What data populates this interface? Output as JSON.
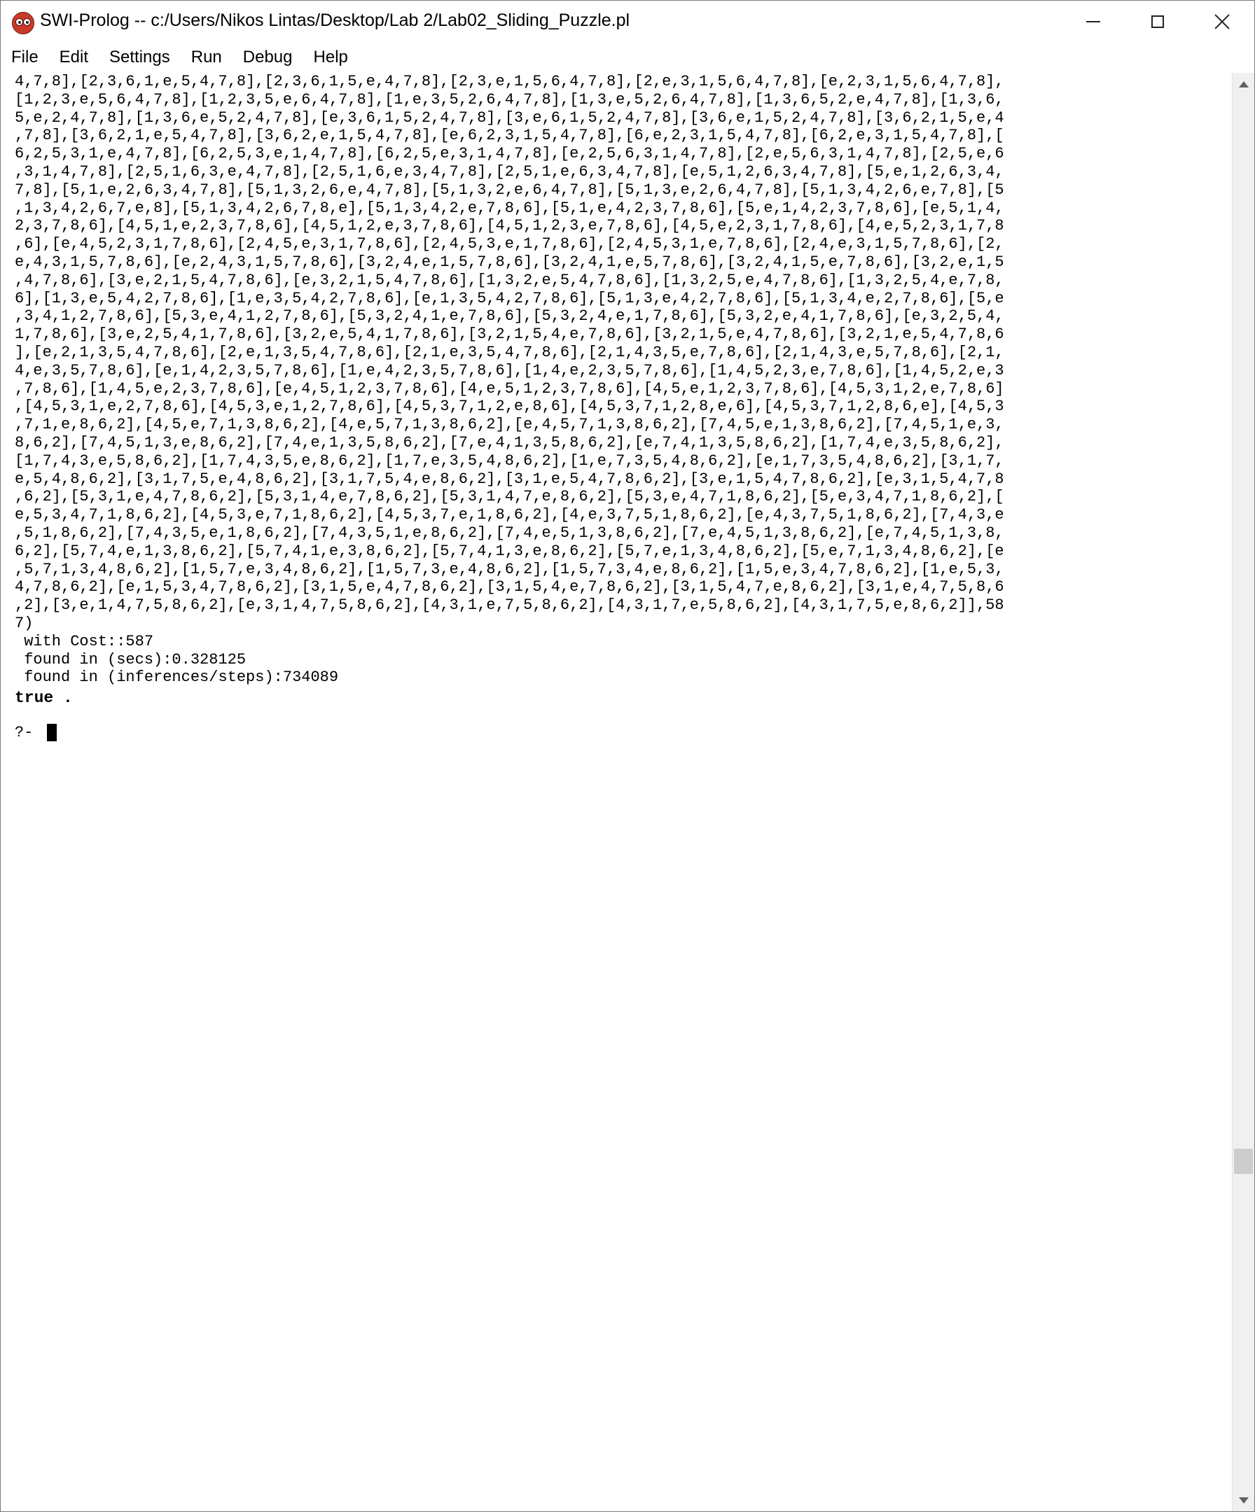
{
  "window": {
    "title": "SWI-Prolog -- c:/Users/Nikos Lintas/Desktop/Lab 2/Lab02_Sliding_Puzzle.pl",
    "icon": "swi-prolog-owl-icon"
  },
  "menu": [
    "File",
    "Edit",
    "Settings",
    "Run",
    "Debug",
    "Help"
  ],
  "console": {
    "output_lines": [
      "4,7,8],[2,3,6,1,e,5,4,7,8],[2,3,6,1,5,e,4,7,8],[2,3,e,1,5,6,4,7,8],[2,e,3,1,5,6,4,7,8],[e,2,3,1,5,6,4,7,8],",
      "[1,2,3,e,5,6,4,7,8],[1,2,3,5,e,6,4,7,8],[1,e,3,5,2,6,4,7,8],[1,3,e,5,2,6,4,7,8],[1,3,6,5,2,e,4,7,8],[1,3,6,",
      "5,e,2,4,7,8],[1,3,6,e,5,2,4,7,8],[e,3,6,1,5,2,4,7,8],[3,e,6,1,5,2,4,7,8],[3,6,e,1,5,2,4,7,8],[3,6,2,1,5,e,4",
      ",7,8],[3,6,2,1,e,5,4,7,8],[3,6,2,e,1,5,4,7,8],[e,6,2,3,1,5,4,7,8],[6,e,2,3,1,5,4,7,8],[6,2,e,3,1,5,4,7,8],[",
      "6,2,5,3,1,e,4,7,8],[6,2,5,3,e,1,4,7,8],[6,2,5,e,3,1,4,7,8],[e,2,5,6,3,1,4,7,8],[2,e,5,6,3,1,4,7,8],[2,5,e,6",
      ",3,1,4,7,8],[2,5,1,6,3,e,4,7,8],[2,5,1,6,e,3,4,7,8],[2,5,1,e,6,3,4,7,8],[e,5,1,2,6,3,4,7,8],[5,e,1,2,6,3,4,",
      "7,8],[5,1,e,2,6,3,4,7,8],[5,1,3,2,6,e,4,7,8],[5,1,3,2,e,6,4,7,8],[5,1,3,e,2,6,4,7,8],[5,1,3,4,2,6,e,7,8],[5",
      ",1,3,4,2,6,7,e,8],[5,1,3,4,2,6,7,8,e],[5,1,3,4,2,e,7,8,6],[5,1,e,4,2,3,7,8,6],[5,e,1,4,2,3,7,8,6],[e,5,1,4,",
      "2,3,7,8,6],[4,5,1,e,2,3,7,8,6],[4,5,1,2,e,3,7,8,6],[4,5,1,2,3,e,7,8,6],[4,5,e,2,3,1,7,8,6],[4,e,5,2,3,1,7,8",
      ",6],[e,4,5,2,3,1,7,8,6],[2,4,5,e,3,1,7,8,6],[2,4,5,3,e,1,7,8,6],[2,4,5,3,1,e,7,8,6],[2,4,e,3,1,5,7,8,6],[2,",
      "e,4,3,1,5,7,8,6],[e,2,4,3,1,5,7,8,6],[3,2,4,e,1,5,7,8,6],[3,2,4,1,e,5,7,8,6],[3,2,4,1,5,e,7,8,6],[3,2,e,1,5",
      ",4,7,8,6],[3,e,2,1,5,4,7,8,6],[e,3,2,1,5,4,7,8,6],[1,3,2,e,5,4,7,8,6],[1,3,2,5,e,4,7,8,6],[1,3,2,5,4,e,7,8,",
      "6],[1,3,e,5,4,2,7,8,6],[1,e,3,5,4,2,7,8,6],[e,1,3,5,4,2,7,8,6],[5,1,3,e,4,2,7,8,6],[5,1,3,4,e,2,7,8,6],[5,e",
      ",3,4,1,2,7,8,6],[5,3,e,4,1,2,7,8,6],[5,3,2,4,1,e,7,8,6],[5,3,2,4,e,1,7,8,6],[5,3,2,e,4,1,7,8,6],[e,3,2,5,4,",
      "1,7,8,6],[3,e,2,5,4,1,7,8,6],[3,2,e,5,4,1,7,8,6],[3,2,1,5,4,e,7,8,6],[3,2,1,5,e,4,7,8,6],[3,2,1,e,5,4,7,8,6",
      "],[e,2,1,3,5,4,7,8,6],[2,e,1,3,5,4,7,8,6],[2,1,e,3,5,4,7,8,6],[2,1,4,3,5,e,7,8,6],[2,1,4,3,e,5,7,8,6],[2,1,",
      "4,e,3,5,7,8,6],[e,1,4,2,3,5,7,8,6],[1,e,4,2,3,5,7,8,6],[1,4,e,2,3,5,7,8,6],[1,4,5,2,3,e,7,8,6],[1,4,5,2,e,3",
      ",7,8,6],[1,4,5,e,2,3,7,8,6],[e,4,5,1,2,3,7,8,6],[4,e,5,1,2,3,7,8,6],[4,5,e,1,2,3,7,8,6],[4,5,3,1,2,e,7,8,6]",
      ",[4,5,3,1,e,2,7,8,6],[4,5,3,e,1,2,7,8,6],[4,5,3,7,1,2,e,8,6],[4,5,3,7,1,2,8,e,6],[4,5,3,7,1,2,8,6,e],[4,5,3",
      ",7,1,e,8,6,2],[4,5,e,7,1,3,8,6,2],[4,e,5,7,1,3,8,6,2],[e,4,5,7,1,3,8,6,2],[7,4,5,e,1,3,8,6,2],[7,4,5,1,e,3,",
      "8,6,2],[7,4,5,1,3,e,8,6,2],[7,4,e,1,3,5,8,6,2],[7,e,4,1,3,5,8,6,2],[e,7,4,1,3,5,8,6,2],[1,7,4,e,3,5,8,6,2],",
      "[1,7,4,3,e,5,8,6,2],[1,7,4,3,5,e,8,6,2],[1,7,e,3,5,4,8,6,2],[1,e,7,3,5,4,8,6,2],[e,1,7,3,5,4,8,6,2],[3,1,7,",
      "e,5,4,8,6,2],[3,1,7,5,e,4,8,6,2],[3,1,7,5,4,e,8,6,2],[3,1,e,5,4,7,8,6,2],[3,e,1,5,4,7,8,6,2],[e,3,1,5,4,7,8",
      ",6,2],[5,3,1,e,4,7,8,6,2],[5,3,1,4,e,7,8,6,2],[5,3,1,4,7,e,8,6,2],[5,3,e,4,7,1,8,6,2],[5,e,3,4,7,1,8,6,2],[",
      "e,5,3,4,7,1,8,6,2],[4,5,3,e,7,1,8,6,2],[4,5,3,7,e,1,8,6,2],[4,e,3,7,5,1,8,6,2],[e,4,3,7,5,1,8,6,2],[7,4,3,e",
      ",5,1,8,6,2],[7,4,3,5,e,1,8,6,2],[7,4,3,5,1,e,8,6,2],[7,4,e,5,1,3,8,6,2],[7,e,4,5,1,3,8,6,2],[e,7,4,5,1,3,8,",
      "6,2],[5,7,4,e,1,3,8,6,2],[5,7,4,1,e,3,8,6,2],[5,7,4,1,3,e,8,6,2],[5,7,e,1,3,4,8,6,2],[5,e,7,1,3,4,8,6,2],[e",
      ",5,7,1,3,4,8,6,2],[1,5,7,e,3,4,8,6,2],[1,5,7,3,e,4,8,6,2],[1,5,7,3,4,e,8,6,2],[1,5,e,3,4,7,8,6,2],[1,e,5,3,",
      "4,7,8,6,2],[e,1,5,3,4,7,8,6,2],[3,1,5,e,4,7,8,6,2],[3,1,5,4,e,7,8,6,2],[3,1,5,4,7,e,8,6,2],[3,1,e,4,7,5,8,6",
      ",2],[3,e,1,4,7,5,8,6,2],[e,3,1,4,7,5,8,6,2],[4,3,1,e,7,5,8,6,2],[4,3,1,7,e,5,8,6,2],[4,3,1,7,5,e,8,6,2]],58",
      "7)",
      " with Cost::587",
      " found in (secs):0.328125",
      " found in (inferences/steps):734089"
    ],
    "result": "true .",
    "prompt": "?- "
  },
  "scrollbar": {
    "position_fraction": 0.77
  }
}
